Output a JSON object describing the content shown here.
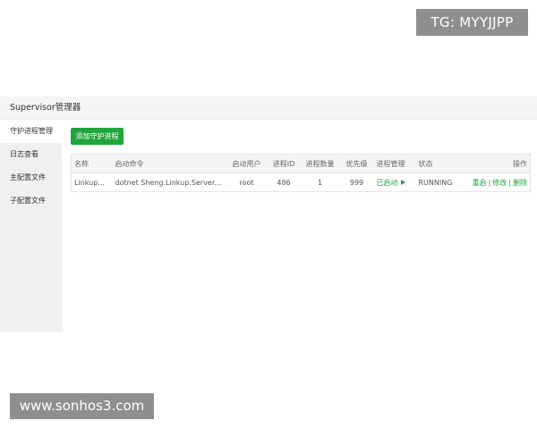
{
  "watermarks": {
    "top": "TG: MYYJJPP",
    "bottom": "www.sonhos3.com"
  },
  "panel": {
    "title": "Supervisor管理器"
  },
  "sidebar": {
    "items": [
      {
        "label": "守护进程管理",
        "active": true
      },
      {
        "label": "日志查看",
        "active": false
      },
      {
        "label": "主配置文件",
        "active": false
      },
      {
        "label": "子配置文件",
        "active": false
      }
    ]
  },
  "toolbar": {
    "add_label": "添加守护进程"
  },
  "table": {
    "headers": {
      "name": "名称",
      "command": "启动命令",
      "user": "启动用户",
      "pid": "进程ID",
      "count": "进程数量",
      "priority": "优先级",
      "manage": "进程管理",
      "status": "状态",
      "ops": "操作"
    },
    "rows": [
      {
        "name": "Linkup...",
        "command": "dotnet Sheng.Linkup.Server.dll",
        "user": "root",
        "pid": "486",
        "count": "1",
        "priority": "999",
        "manage": "已启动",
        "manage_icon": "play-icon",
        "status": "RUNNING",
        "ops": {
          "restart": "重启",
          "edit": "修改",
          "delete": "删除",
          "separator": "|"
        }
      }
    ]
  },
  "colors": {
    "accent": "#20a53a",
    "watermark_bg": "#8f8f8f",
    "sidebar_bg": "#f0f0f0",
    "header_bg": "#f5f5f5"
  }
}
